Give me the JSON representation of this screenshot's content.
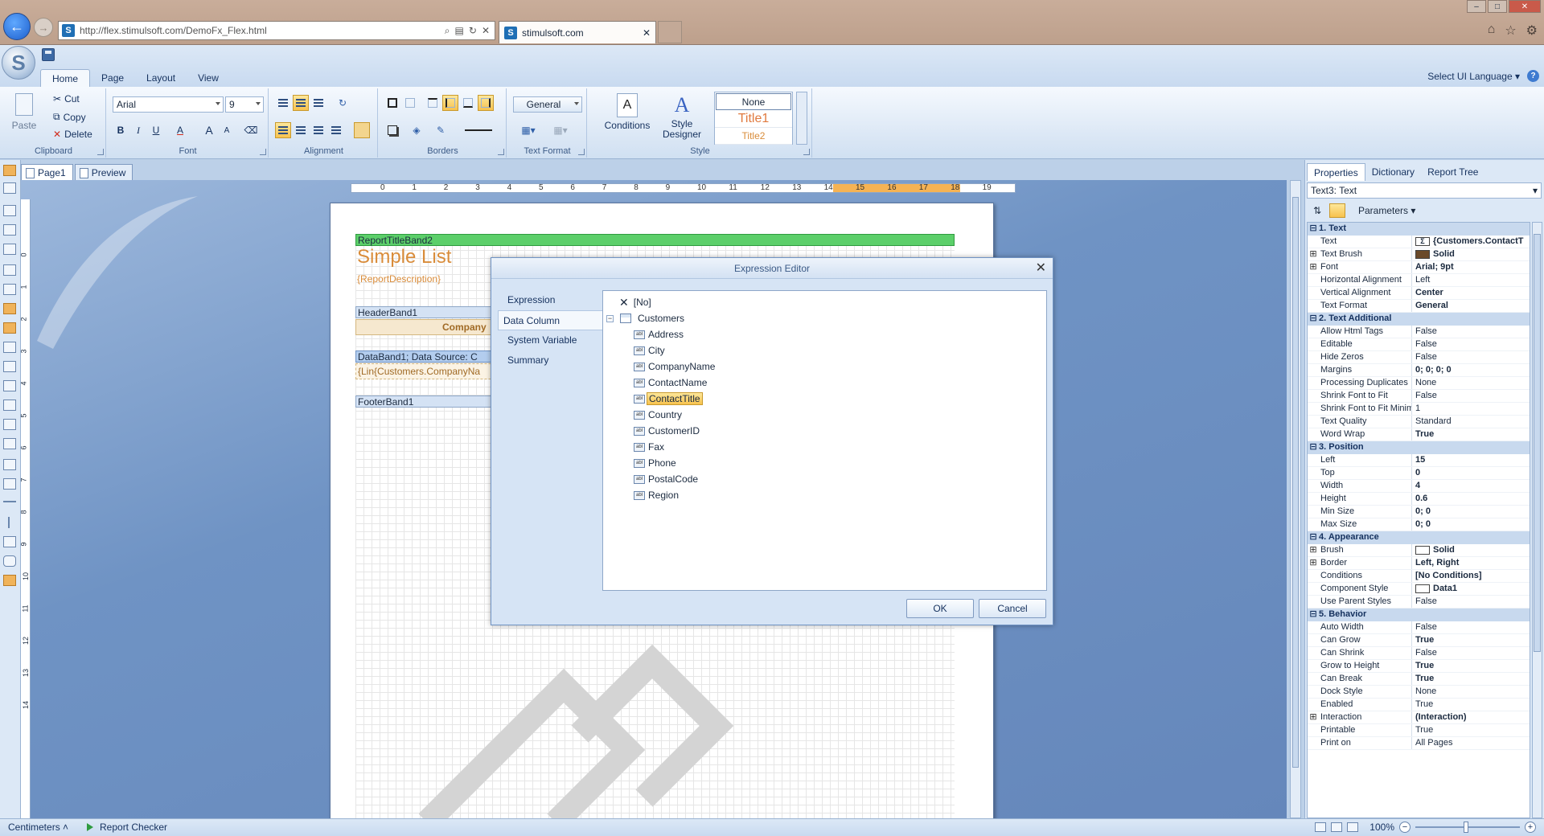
{
  "browser": {
    "url": "http://flex.stimulsoft.com/DemoFx_Flex.html",
    "tab_title": "stimulsoft.com",
    "site_icon_letter": "S"
  },
  "app": {
    "ribbon_tabs": [
      "Home",
      "Page",
      "Layout",
      "View"
    ],
    "active_tab": "Home",
    "ui_language": "Select UI Language",
    "help": "?"
  },
  "ribbon": {
    "clipboard": {
      "paste": "Paste",
      "cut": "Cut",
      "copy": "Copy",
      "delete": "Delete",
      "label": "Clipboard"
    },
    "font": {
      "family": "Arial",
      "size": "9",
      "bold": "B",
      "italic": "I",
      "underline": "U",
      "color": "A",
      "grow": "A",
      "shrink": "A",
      "label": "Font"
    },
    "alignment": {
      "label": "Alignment"
    },
    "borders": {
      "label": "Borders"
    },
    "text_format": {
      "value": "General",
      "label": "Text Format"
    },
    "conditions": "Conditions",
    "style_designer": [
      "Style",
      "Designer"
    ],
    "style": {
      "label": "Style",
      "gallery": [
        "None",
        "Title1",
        "Title2"
      ]
    }
  },
  "doc_tabs": [
    "Page1",
    "Preview"
  ],
  "ruler": {
    "h": [
      "0",
      "1",
      "2",
      "3",
      "4",
      "5",
      "6",
      "7",
      "8",
      "9",
      "10",
      "11",
      "12",
      "13",
      "14",
      "15",
      "16",
      "17",
      "18",
      "19"
    ],
    "v": [
      "0",
      "1",
      "2",
      "3",
      "4",
      "5",
      "6",
      "7",
      "8",
      "9",
      "10",
      "11",
      "12",
      "13",
      "14"
    ]
  },
  "report": {
    "title_band": "ReportTitleBand2",
    "title": "Simple List",
    "description": "{ReportDescription}",
    "header_band": "HeaderBand1",
    "company_header": "Company",
    "data_band": "DataBand1; Data Source: C",
    "data_cell": "{Lin{Customers.CompanyNa",
    "footer_band": "FooterBand1"
  },
  "dialog": {
    "title": "Expression Editor",
    "close": "✕",
    "nav": [
      "Expression",
      "Data Column",
      "System Variable",
      "Summary"
    ],
    "active_nav": "Data Column",
    "tree": {
      "no_item": "[No]",
      "datasource": "Customers",
      "columns": [
        "Address",
        "City",
        "CompanyName",
        "ContactName",
        "ContactTitle",
        "Country",
        "CustomerID",
        "Fax",
        "Phone",
        "PostalCode",
        "Region"
      ],
      "selected": "ContactTitle",
      "col_icon_text": "abl"
    },
    "ok": "OK",
    "cancel": "Cancel"
  },
  "panel": {
    "tabs": [
      "Properties",
      "Dictionary",
      "Report Tree"
    ],
    "active_tab": "Properties",
    "component": "Text3: Text",
    "toolbar_label": "Parameters",
    "categories": [
      {
        "name": "1. Text",
        "rows": [
          {
            "name": "Text",
            "value": "{Customers.ContactT",
            "bold": true,
            "icon": "sum"
          },
          {
            "name": "Text Brush",
            "value": "Solid",
            "bold": true,
            "expander": "+",
            "swatch": "#6b4a2a"
          },
          {
            "name": "Font",
            "value": "Arial; 9pt",
            "bold": true,
            "expander": "+"
          },
          {
            "name": "Horizontal Alignment",
            "value": "Left"
          },
          {
            "name": "Vertical Alignment",
            "value": "Center",
            "bold": true
          },
          {
            "name": "Text Format",
            "value": "General",
            "bold": true
          }
        ]
      },
      {
        "name": "2. Text Additional",
        "rows": [
          {
            "name": "Allow Html Tags",
            "value": "False"
          },
          {
            "name": "Editable",
            "value": "False"
          },
          {
            "name": "Hide Zeros",
            "value": "False"
          },
          {
            "name": "Margins",
            "value": "0; 0; 0; 0",
            "bold": true
          },
          {
            "name": "Processing Duplicates",
            "value": "None"
          },
          {
            "name": "Shrink Font to Fit",
            "value": "False"
          },
          {
            "name": "Shrink Font to Fit Minim",
            "value": "1"
          },
          {
            "name": "Text Quality",
            "value": "Standard"
          },
          {
            "name": "Word Wrap",
            "value": "True",
            "bold": true
          }
        ]
      },
      {
        "name": "3. Position",
        "rows": [
          {
            "name": "Left",
            "value": "15",
            "bold": true
          },
          {
            "name": "Top",
            "value": "0",
            "bold": true
          },
          {
            "name": "Width",
            "value": "4",
            "bold": true
          },
          {
            "name": "Height",
            "value": "0.6",
            "bold": true
          },
          {
            "name": "Min Size",
            "value": "0; 0",
            "bold": true
          },
          {
            "name": "Max Size",
            "value": "0; 0",
            "bold": true
          }
        ]
      },
      {
        "name": "4. Appearance",
        "rows": [
          {
            "name": "Brush",
            "value": "Solid",
            "bold": true,
            "expander": "+",
            "swatch": "#ffffff"
          },
          {
            "name": "Border",
            "value": "Left, Right",
            "bold": true,
            "expander": "+"
          },
          {
            "name": "Conditions",
            "value": "[No Conditions]",
            "bold": true
          },
          {
            "name": "Component Style",
            "value": "Data1",
            "bold": true,
            "swatch": "#ffffff"
          },
          {
            "name": "Use Parent Styles",
            "value": "False"
          }
        ]
      },
      {
        "name": "5. Behavior",
        "rows": [
          {
            "name": "Auto Width",
            "value": "False"
          },
          {
            "name": "Can Grow",
            "value": "True",
            "bold": true
          },
          {
            "name": "Can Shrink",
            "value": "False"
          },
          {
            "name": "Grow to Height",
            "value": "True",
            "bold": true
          },
          {
            "name": "Can Break",
            "value": "True",
            "bold": true
          },
          {
            "name": "Dock Style",
            "value": "None"
          },
          {
            "name": "Enabled",
            "value": "True"
          },
          {
            "name": "Interaction",
            "value": "(Interaction)",
            "bold": true,
            "expander": "+"
          },
          {
            "name": "Printable",
            "value": "True"
          },
          {
            "name": "Print on",
            "value": "All Pages"
          }
        ]
      }
    ]
  },
  "status": {
    "units": "Centimeters",
    "report_checker": "Report Checker",
    "zoom": "100%"
  }
}
